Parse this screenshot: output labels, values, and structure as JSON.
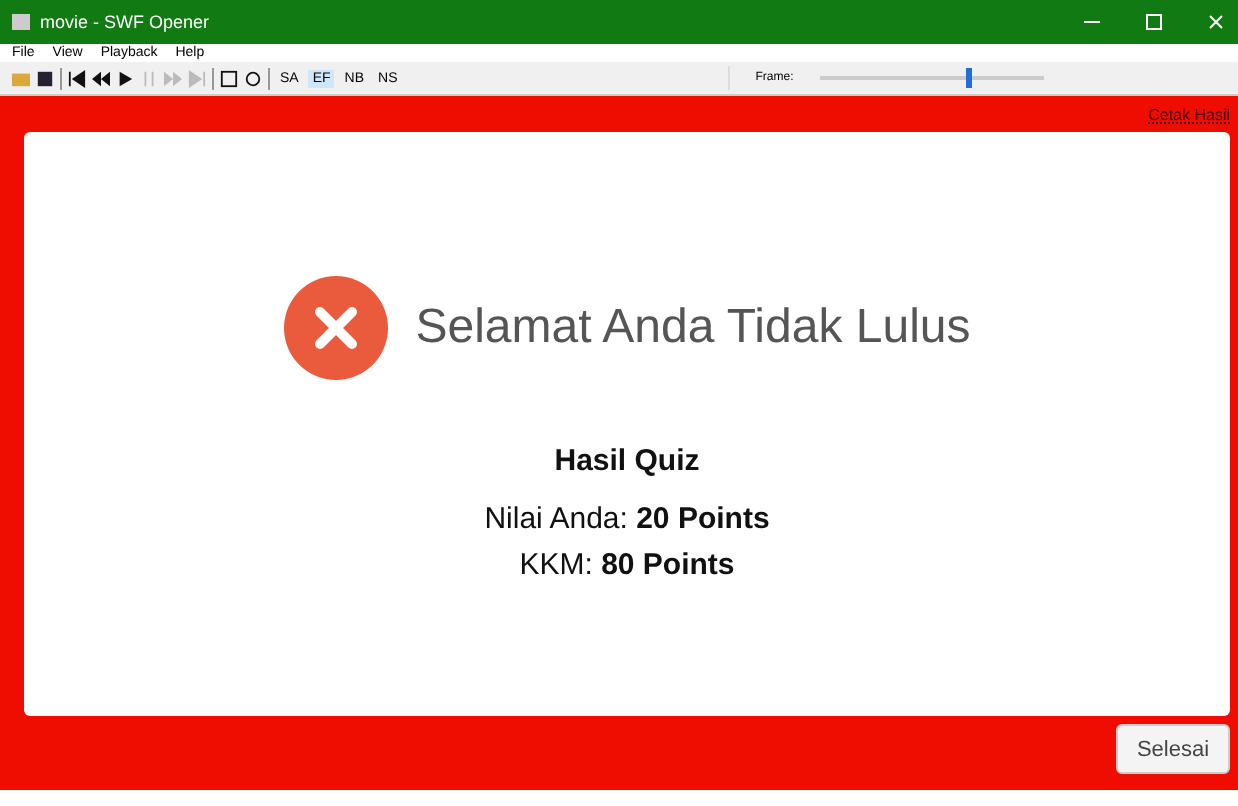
{
  "window": {
    "title": "movie - SWF Opener"
  },
  "menu": [
    "File",
    "View",
    "Playback",
    "Help"
  ],
  "toolbar": {
    "modes": [
      {
        "label": "SA",
        "selected": false
      },
      {
        "label": "EF",
        "selected": true
      },
      {
        "label": "NB",
        "selected": false
      },
      {
        "label": "NS",
        "selected": false
      }
    ],
    "frame": {
      "label": "Frame:",
      "level": 0.65
    }
  },
  "content": {
    "print_link": "Cetak Hasil",
    "heading": "Selamat Anda Tidak Lulus",
    "result_title": "Hasil Quiz",
    "score": "Nilai Anda: **20 Points**",
    "kkm": "KKM: **80 Points**",
    "finish_button": "Selesai"
  }
}
